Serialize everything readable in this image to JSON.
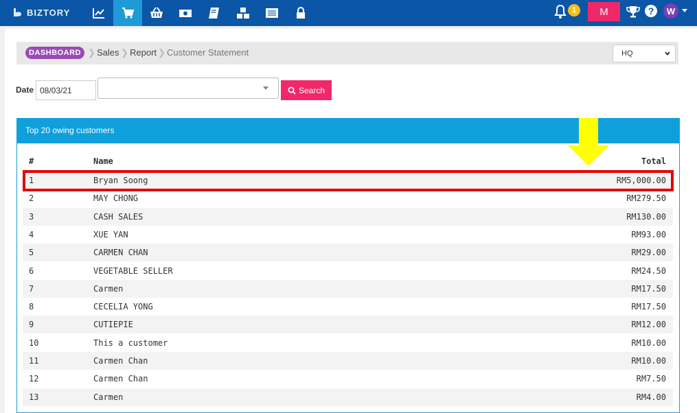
{
  "brand": {
    "name": "BIZTORY"
  },
  "nav": {
    "icons": [
      "chart-icon",
      "cart-icon",
      "basket-icon",
      "money-icon",
      "book-icon",
      "boxes-icon",
      "list-icon",
      "lock-icon"
    ],
    "active": "cart-icon",
    "notifications_count": "1",
    "m_button": "M",
    "avatar_initial": "W"
  },
  "breadcrumb": {
    "dashboard": "DASHBOARD",
    "items": [
      "Sales",
      "Report",
      "Customer Statement"
    ]
  },
  "branch_select": {
    "value": "HQ"
  },
  "filters": {
    "date_label": "Date",
    "date_value": "08/03/21",
    "customer_value": "",
    "search_label": "Search"
  },
  "panel": {
    "title": "Top 20 owing customers",
    "columns": [
      "#",
      "Name",
      "Total"
    ],
    "rows": [
      {
        "num": "1",
        "name": "Bryan Soong",
        "total": "RM5,000.00"
      },
      {
        "num": "2",
        "name": "MAY CHONG",
        "total": "RM279.50"
      },
      {
        "num": "3",
        "name": "CASH SALES",
        "total": "RM130.00"
      },
      {
        "num": "4",
        "name": "XUE YAN",
        "total": "RM93.00"
      },
      {
        "num": "5",
        "name": "CARMEN CHAN",
        "total": "RM29.00"
      },
      {
        "num": "6",
        "name": "VEGETABLE SELLER",
        "total": "RM24.50"
      },
      {
        "num": "7",
        "name": "Carmen",
        "total": "RM17.50"
      },
      {
        "num": "8",
        "name": "CECELIA YONG",
        "total": "RM17.50"
      },
      {
        "num": "9",
        "name": "CUTIEPIE",
        "total": "RM12.00"
      },
      {
        "num": "10",
        "name": "This a customer",
        "total": "RM10.00"
      },
      {
        "num": "11",
        "name": "Carmen Chan",
        "total": "RM10.00"
      },
      {
        "num": "12",
        "name": "Carmen Chan",
        "total": "RM7.50"
      },
      {
        "num": "13",
        "name": "Carmen",
        "total": "RM4.00"
      }
    ]
  },
  "colors": {
    "nav_bg": "#0b56a6",
    "accent": "#1e9ad6",
    "pink": "#f0286a",
    "purple": "#9b4bb8",
    "highlight_red": "#e00000",
    "arrow_yellow": "#ffff00"
  }
}
